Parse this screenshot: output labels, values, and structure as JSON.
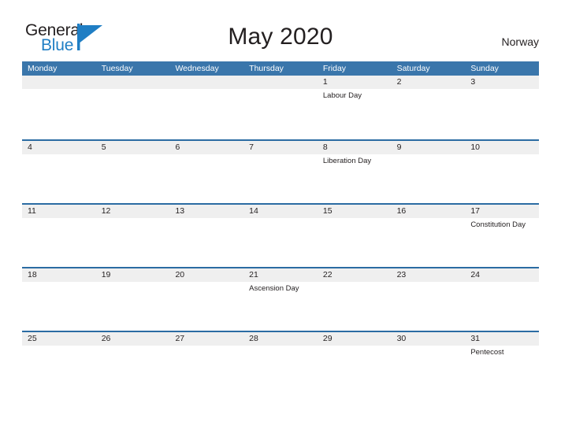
{
  "brand": {
    "word_one": "General",
    "word_two": "Blue",
    "mark_icon": "triangle-flag-icon",
    "color_dark": "#231f20",
    "color_blue": "#1f7ec4"
  },
  "header": {
    "title": "May 2020",
    "country": "Norway"
  },
  "theme": {
    "header_blue": "#3a76ab",
    "rule_blue": "#2b6ca3",
    "band_gray": "#efefef",
    "text": "#231f20"
  },
  "calendar": {
    "weekday_headers": [
      "Monday",
      "Tuesday",
      "Wednesday",
      "Thursday",
      "Friday",
      "Saturday",
      "Sunday"
    ],
    "weeks": [
      [
        {
          "num": "",
          "events": []
        },
        {
          "num": "",
          "events": []
        },
        {
          "num": "",
          "events": []
        },
        {
          "num": "",
          "events": []
        },
        {
          "num": "1",
          "events": [
            "Labour Day"
          ]
        },
        {
          "num": "2",
          "events": []
        },
        {
          "num": "3",
          "events": []
        }
      ],
      [
        {
          "num": "4",
          "events": []
        },
        {
          "num": "5",
          "events": []
        },
        {
          "num": "6",
          "events": []
        },
        {
          "num": "7",
          "events": []
        },
        {
          "num": "8",
          "events": [
            "Liberation Day"
          ]
        },
        {
          "num": "9",
          "events": []
        },
        {
          "num": "10",
          "events": []
        }
      ],
      [
        {
          "num": "11",
          "events": []
        },
        {
          "num": "12",
          "events": []
        },
        {
          "num": "13",
          "events": []
        },
        {
          "num": "14",
          "events": []
        },
        {
          "num": "15",
          "events": []
        },
        {
          "num": "16",
          "events": []
        },
        {
          "num": "17",
          "events": [
            "Constitution Day"
          ]
        }
      ],
      [
        {
          "num": "18",
          "events": []
        },
        {
          "num": "19",
          "events": []
        },
        {
          "num": "20",
          "events": []
        },
        {
          "num": "21",
          "events": [
            "Ascension Day"
          ]
        },
        {
          "num": "22",
          "events": []
        },
        {
          "num": "23",
          "events": []
        },
        {
          "num": "24",
          "events": []
        }
      ],
      [
        {
          "num": "25",
          "events": []
        },
        {
          "num": "26",
          "events": []
        },
        {
          "num": "27",
          "events": []
        },
        {
          "num": "28",
          "events": []
        },
        {
          "num": "29",
          "events": []
        },
        {
          "num": "30",
          "events": []
        },
        {
          "num": "31",
          "events": [
            "Pentecost"
          ]
        }
      ]
    ]
  }
}
